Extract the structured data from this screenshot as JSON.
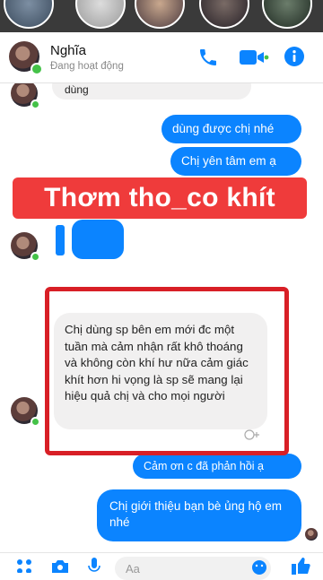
{
  "header": {
    "contact_name": "Nghĩa",
    "contact_status": "Đang hoạt động"
  },
  "overlay": {
    "title": "Thơm tho_co khít"
  },
  "messages": {
    "in_top_partial": "dùng",
    "out_1": "dùng được chị nhé",
    "out_2": "Chị yên tâm em ạ",
    "in_main": "Chị dùng sp bên em mới đc một tuần mà cảm nhận rất khô thoáng và không còn khí hư nữa cảm giác khít hơn hi vọng là sp sẽ mang lại hiệu quả chị và cho mọi người",
    "out_3_partial": "Cảm ơn c đã phản hồi ạ",
    "out_4": "Chị giới thiệu bạn bè ủng hộ em nhé"
  },
  "composer": {
    "placeholder": "Aa"
  },
  "colors": {
    "messenger_blue": "#0b84ff",
    "online_green": "#44c248",
    "highlight_red": "#d81f26"
  }
}
